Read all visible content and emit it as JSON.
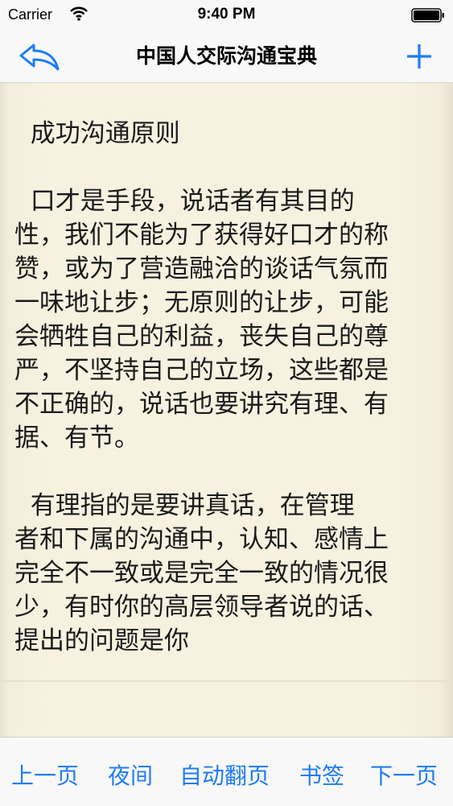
{
  "status_bar": {
    "carrier": "Carrier",
    "time": "9:40 PM"
  },
  "nav": {
    "title": "中国人交际沟通宝典",
    "back_icon": "reply-arrow-icon",
    "add_icon": "plus-icon",
    "accent_color": "#1e7cf6"
  },
  "article": {
    "lines": [
      "  成功沟通原则",
      "",
      "  口才是手段，说话者有其目的",
      "性，我们不能为了获得好口才的称",
      "赞，或为了营造融洽的谈话气氛而",
      "一味地让步；无原则的让步，可能",
      "会牺牲自己的利益，丧失自己的尊",
      "严，不坚持自己的立场，这些都是",
      "不正确的，说话也要讲究有理、有",
      "据、有节。",
      "",
      "  有理指的是要讲真话，在管理",
      "者和下属的沟通中，认知、感情上",
      "完全不一致或是完全一致的情况很",
      "少，有时你的高层领导者说的话、",
      "提出的问题是你"
    ]
  },
  "toolbar": {
    "prev_label": "上一页",
    "night_label": "夜间",
    "autoflip_label": "自动翻页",
    "bookmark_label": "书签",
    "next_label": "下一页"
  }
}
